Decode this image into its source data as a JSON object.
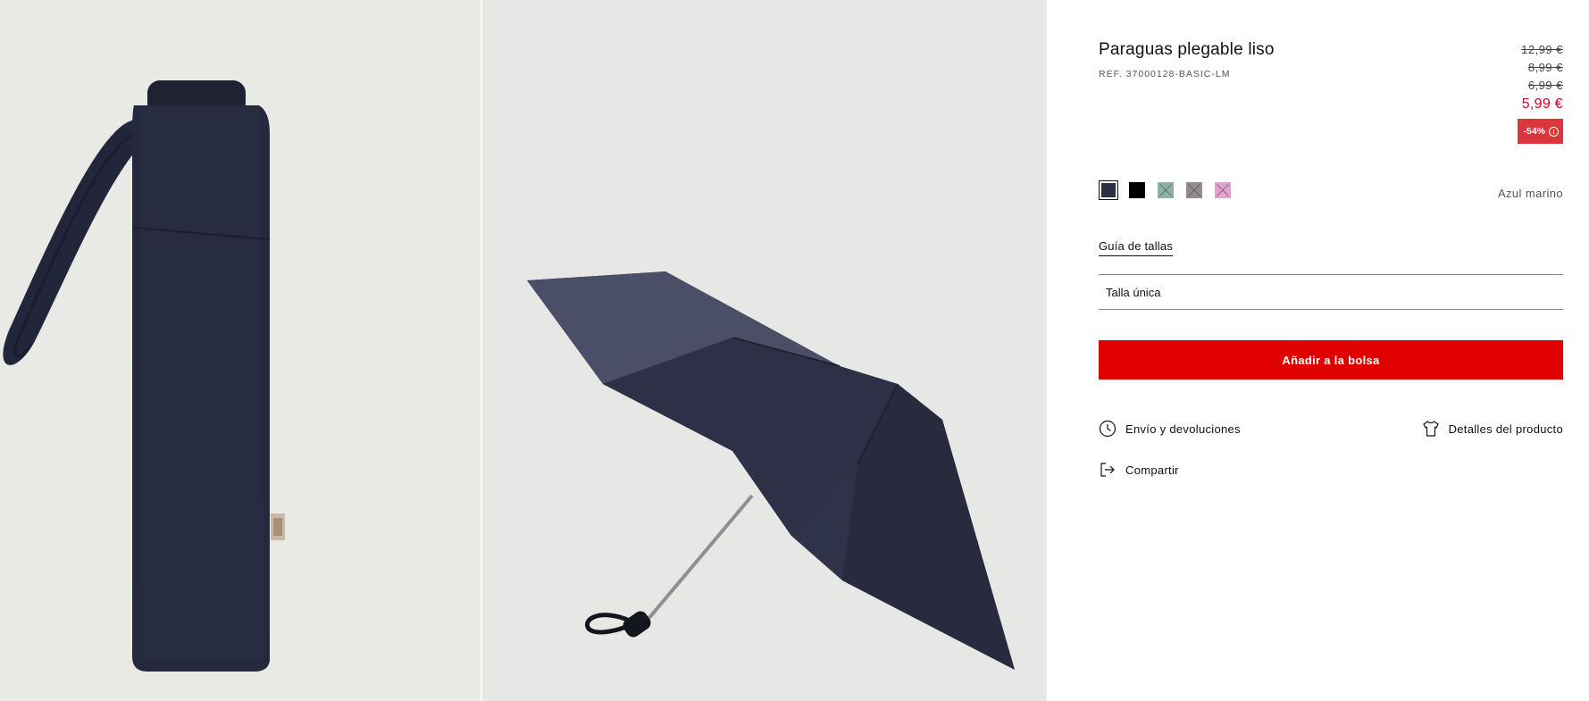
{
  "gallery": {
    "images": [
      {
        "alt": "folded-umbrella"
      },
      {
        "alt": "open-umbrella"
      }
    ]
  },
  "product": {
    "title": "Paraguas plegable liso",
    "reference": "REF. 37000128-BASIC-LM",
    "old_prices": [
      "12,99 €",
      "8,99 €",
      "6,99 €"
    ],
    "current_price": "5,99 €",
    "discount": "-54%",
    "price_color": "#d0021b",
    "discount_color": "#d9363e"
  },
  "colors": {
    "swatches": [
      {
        "name": "navy",
        "hex": "#2b3145",
        "selected": true,
        "available": true
      },
      {
        "name": "black",
        "hex": "#000000",
        "selected": false,
        "available": true
      },
      {
        "name": "green",
        "hex": "#8fb3a3",
        "selected": false,
        "available": false
      },
      {
        "name": "grey",
        "hex": "#948c8c",
        "selected": false,
        "available": false
      },
      {
        "name": "pink",
        "hex": "#e2a4cf",
        "selected": false,
        "available": false
      }
    ],
    "selected_name": "Azul marino"
  },
  "size": {
    "guide_label": "Guía de tallas",
    "selected": "Talla única"
  },
  "cart": {
    "add_label": "Añadir a la bolsa",
    "button_color": "#e00000"
  },
  "actions": {
    "shipping_label": "Envío y devoluciones",
    "shipping_icon": "clock-icon",
    "details_label": "Detalles del producto",
    "details_icon": "tshirt-icon",
    "share_label": "Compartir",
    "share_icon": "share-icon"
  }
}
